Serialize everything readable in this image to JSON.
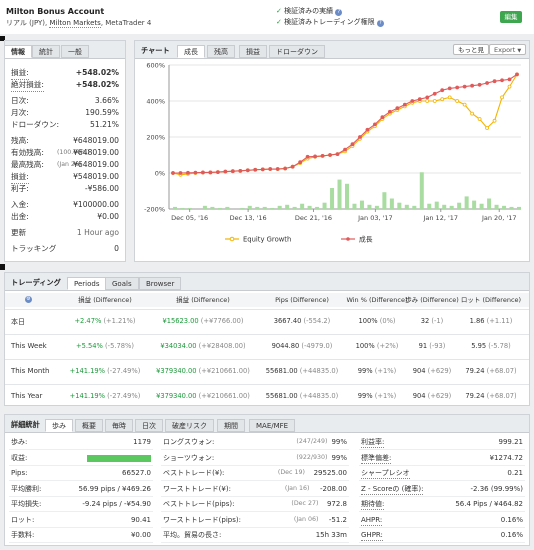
{
  "account": {
    "title": "Milton Bonus Account",
    "subtitle_prefix": "リアル (JPY), ",
    "broker": "Milton Markets",
    "subtitle_suffix": ", MetaTrader 4",
    "verified_track": "検証済みの実績",
    "verified_permissions": "検証済みトレーディング権限",
    "follow_button": "編集"
  },
  "info": {
    "tabs": [
      "情報",
      "統計",
      "一般"
    ],
    "rows": [
      {
        "label": "損益:",
        "value": "+548.02%"
      },
      {
        "label": "絶対損益:",
        "value": "+548.02%"
      },
      {
        "label": "日次:",
        "value": "3.66%"
      },
      {
        "label": "月次:",
        "value": "190.59%"
      },
      {
        "label": "ドローダウン:",
        "value": "51.21%"
      },
      {
        "label": "残高:",
        "value": "¥648019.00"
      },
      {
        "label": "有効残高:",
        "note": "(100.00%)",
        "value": "¥648019.00"
      },
      {
        "label": "最高残高:",
        "note": "(Jan 26)",
        "value": "¥648019.00"
      },
      {
        "label": "損益:",
        "value": "¥548019.00"
      },
      {
        "label": "利子:",
        "value": "-¥586.00"
      },
      {
        "label": "入金:",
        "value": "¥100000.00"
      },
      {
        "label": "出金:",
        "value": "¥0.00"
      },
      {
        "label": "更新",
        "value": "1 Hour ago"
      },
      {
        "label": "トラッキング",
        "value": "0"
      }
    ]
  },
  "chart_panel": {
    "title": "チャート",
    "tabs": [
      "成長",
      "残高",
      "損益",
      "ドローダウン"
    ],
    "more_button": "もっと見",
    "export_button": "Export",
    "legend_equity": "Equity Growth",
    "legend_growth": "成長"
  },
  "chart_data": {
    "type": "line",
    "y_ticks": [
      "600%",
      "400%",
      "200%",
      "0%",
      "-200%"
    ],
    "ylim": [
      -200,
      600
    ],
    "x_ticks": [
      "Dec 05, '16",
      "Dec 13, '16",
      "Dec 21, '16",
      "Jan 03, '17",
      "Jan 12, '17",
      "Jan 20, '17"
    ],
    "series": [
      {
        "name": "成長",
        "color": "#e05a5a",
        "values": [
          0,
          0,
          1,
          2,
          3,
          3,
          5,
          8,
          10,
          12,
          15,
          18,
          20,
          22,
          22,
          25,
          35,
          60,
          90,
          92,
          95,
          100,
          105,
          130,
          160,
          200,
          240,
          270,
          310,
          340,
          360,
          380,
          400,
          410,
          420,
          440,
          460,
          470,
          475,
          480,
          485,
          490,
          500,
          510,
          515,
          520,
          548
        ]
      },
      {
        "name": "Equity Growth",
        "color": "#f4b400",
        "values": [
          0,
          -10,
          -5,
          0,
          2,
          3,
          5,
          7,
          10,
          12,
          15,
          18,
          20,
          22,
          22,
          25,
          35,
          55,
          80,
          90,
          95,
          100,
          105,
          120,
          150,
          190,
          230,
          260,
          300,
          330,
          350,
          370,
          390,
          400,
          400,
          400,
          410,
          420,
          400,
          380,
          330,
          300,
          250,
          290,
          420,
          480,
          548
        ]
      }
    ],
    "bars": [
      2,
      1,
      1,
      0,
      3,
      2,
      1,
      2,
      0,
      1,
      3,
      2,
      2,
      1,
      3,
      4,
      2,
      5,
      3,
      2,
      6,
      20,
      28,
      24,
      5,
      8,
      4,
      3,
      16,
      10,
      6,
      4,
      3,
      35,
      5,
      7,
      4,
      3,
      6,
      12,
      8,
      5,
      10,
      4,
      3,
      2,
      2
    ]
  },
  "trading": {
    "title": "トレーディング",
    "tabs": [
      "Periods",
      "Goals",
      "Browser"
    ],
    "headers": [
      "損益 (Difference)",
      "損益 (Difference)",
      "Pips (Difference)",
      "Win % (Difference)",
      "歩み (Difference)",
      "ロット (Difference)"
    ],
    "rows": [
      {
        "label": "本日",
        "c1": "+2.47%",
        "c1d": "(+1.21%)",
        "c2": "¥15623.00",
        "c2d": "(+¥7766.00)",
        "c3": "3667.40",
        "c3d": "(-554.2)",
        "c4": "100%",
        "c4d": "(0%)",
        "c5": "32",
        "c5d": "(-1)",
        "c6": "1.86",
        "c6d": "(+1.11)"
      },
      {
        "label": "This Week",
        "c1": "+5.54%",
        "c1d": "(-5.78%)",
        "c2": "¥34034.00",
        "c2d": "(+¥28408.00)",
        "c3": "9044.80",
        "c3d": "(-4979.0)",
        "c4": "100%",
        "c4d": "(+2%)",
        "c5": "91",
        "c5d": "(-93)",
        "c6": "5.95",
        "c6d": "(-5.78)"
      },
      {
        "label": "This Month",
        "c1": "+141.19%",
        "c1d": "(-27.49%)",
        "c2": "¥379340.00",
        "c2d": "(+¥210661.00)",
        "c3": "55681.00",
        "c3d": "(+44835.0)",
        "c4": "99%",
        "c4d": "(+1%)",
        "c5": "904",
        "c5d": "(+629)",
        "c6": "79.24",
        "c6d": "(+68.07)"
      },
      {
        "label": "This Year",
        "c1": "+141.19%",
        "c1d": "(-27.49%)",
        "c2": "¥379340.00",
        "c2d": "(+¥210661.00)",
        "c3": "55681.00",
        "c3d": "(+44835.0)",
        "c4": "99%",
        "c4d": "(+1%)",
        "c5": "904",
        "c5d": "(+629)",
        "c6": "79.24",
        "c6d": "(+68.07)"
      }
    ]
  },
  "details": {
    "title": "詳細統計",
    "tabs": [
      "歩み",
      "概要",
      "毎時",
      "日次",
      "破産リスク",
      "期間",
      "MAE/MFE"
    ],
    "col1": [
      {
        "label": "歩み:",
        "value": "1179"
      },
      {
        "label": "収益:",
        "value": ""
      },
      {
        "label": "Pips:",
        "value": "66527.0"
      },
      {
        "label": "平均勝利:",
        "value": "56.99 pips / ¥469.26"
      },
      {
        "label": "平均損失:",
        "value": "-9.24 pips / -¥54.90"
      },
      {
        "label": "ロット:",
        "value": "90.41"
      },
      {
        "label": "手数料:",
        "value": "¥0.00"
      }
    ],
    "col2": [
      {
        "label": "ロングスウォン:",
        "note": "(247/249)",
        "value": "99%"
      },
      {
        "label": "ショーツウォン:",
        "note": "(922/930)",
        "value": "99%"
      },
      {
        "label": "ベストトレード(¥):",
        "note": "(Dec 19)",
        "value": "29525.00"
      },
      {
        "label": "ワーストトレード(¥):",
        "note": "(Jan 16)",
        "value": "-208.00"
      },
      {
        "label": "ベストトレード(pips):",
        "note": "(Dec 27)",
        "value": "972.8"
      },
      {
        "label": "ワーストトレード(pips):",
        "note": "(Jan 06)",
        "value": "-51.2"
      },
      {
        "label": "平均。貿易の長さ:",
        "value": "15h 33m"
      }
    ],
    "col3": [
      {
        "label": "利益率:",
        "value": "999.21"
      },
      {
        "label": "標準偏差:",
        "value": "¥1274.72"
      },
      {
        "label": "シャープレシオ",
        "value": "0.21"
      },
      {
        "label": "Z - Scoreの (確率):",
        "value": "-2.36 (99.99%)"
      },
      {
        "label": "期待値:",
        "value": "56.4 Pips / ¥464.82"
      },
      {
        "label": "AHPR:",
        "value": "0.16%"
      },
      {
        "label": "GHPR:",
        "value": "0.16%"
      }
    ]
  }
}
